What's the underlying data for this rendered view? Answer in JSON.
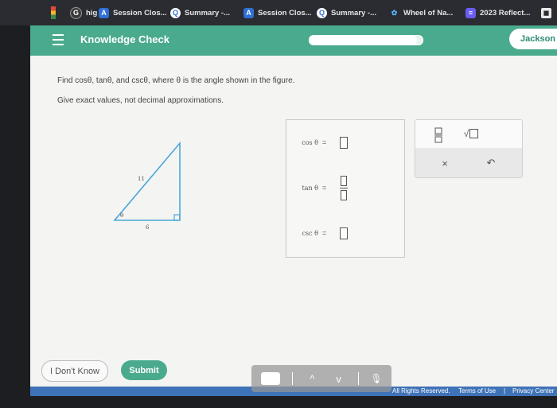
{
  "browser": {
    "tabs": [
      {
        "label": "hig",
        "icon": "google-icon"
      },
      {
        "label": "Session Clos...",
        "icon": "a-app-icon"
      },
      {
        "label": "Summary -...",
        "icon": "q-app-icon"
      },
      {
        "label": "Session Clos...",
        "icon": "a-app-icon"
      },
      {
        "label": "Summary -...",
        "icon": "q-app-icon"
      },
      {
        "label": "Wheel of Na...",
        "icon": "wheel-icon"
      },
      {
        "label": "2023 Reflect...",
        "icon": "doc-icon"
      }
    ]
  },
  "header": {
    "title": "Knowledge Check",
    "user": "Jackson ",
    "progress_fraction": 0.95
  },
  "question": {
    "prompt": "Find cosθ, tanθ, and cscθ, where θ is the angle shown in the figure.",
    "instructions": "Give exact values, not decimal approximations."
  },
  "figure": {
    "hypotenuse": "11",
    "base": "6",
    "angle": "θ"
  },
  "answers": [
    {
      "label": "cos θ",
      "sign": "=",
      "input": "single"
    },
    {
      "label": "tan θ",
      "sign": "=",
      "input": "fraction"
    },
    {
      "label": "csc θ",
      "sign": "=",
      "input": "single"
    }
  ],
  "tools": {
    "fraction": "fraction-icon",
    "sqrt": "√",
    "clear": "×",
    "undo": "↶"
  },
  "buttons": {
    "dont_know": "I Don't Know",
    "submit": "Submit"
  },
  "footer": {
    "rights": "All Rights Reserved.",
    "terms": "Terms of Use",
    "separator": "|",
    "privacy": "Privacy Center"
  },
  "overlay": {
    "up": "^",
    "down": "v"
  },
  "colors": {
    "brand": "#4aaa8d",
    "footer": "#3f73b8",
    "triangle": "#4aa6d8"
  }
}
